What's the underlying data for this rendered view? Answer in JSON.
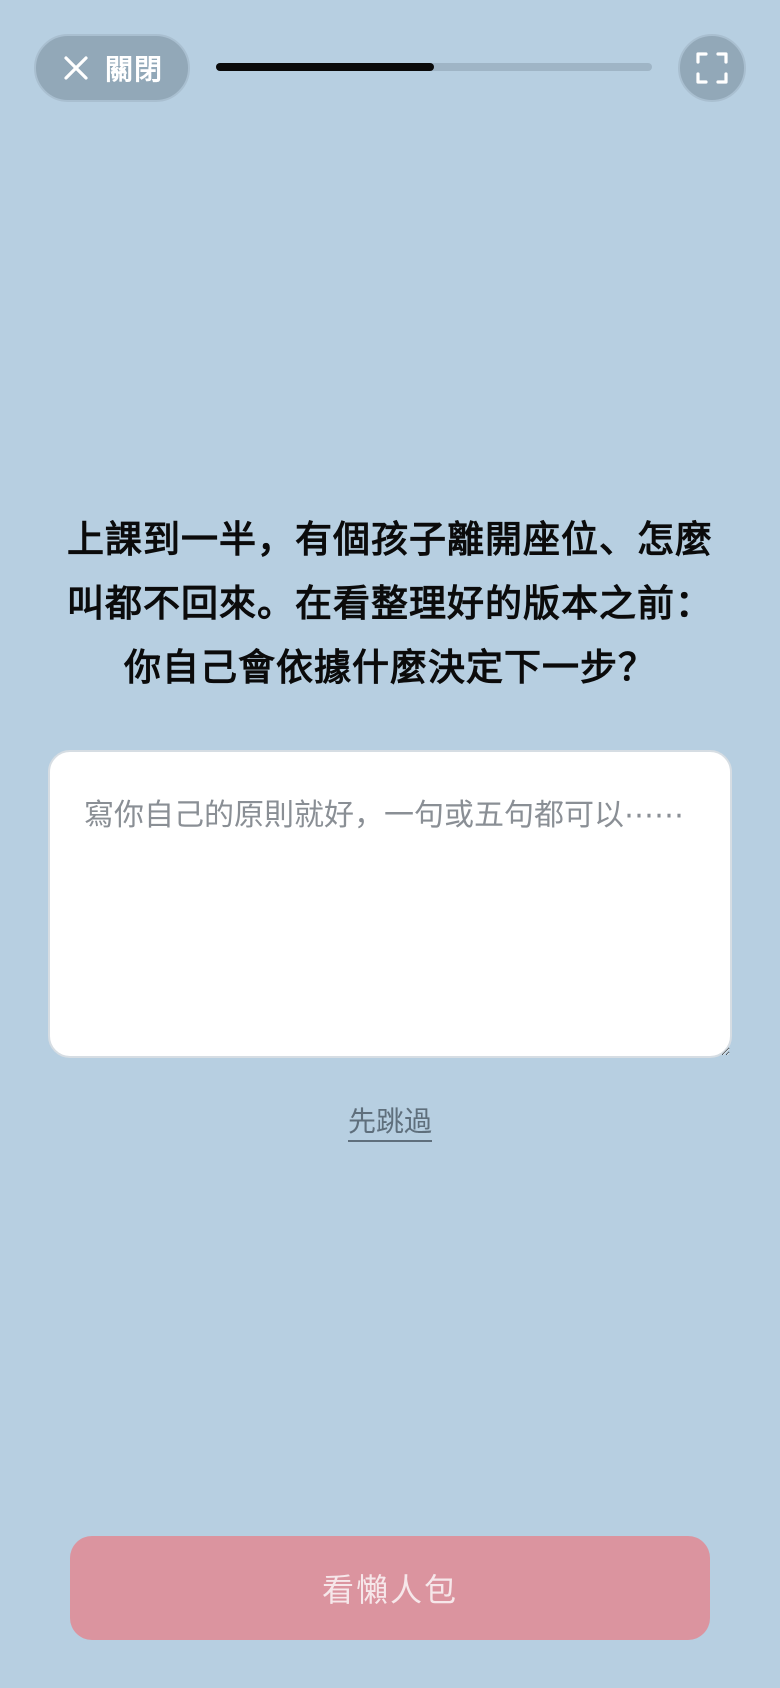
{
  "header": {
    "close_label": "關閉",
    "close_icon": "close-icon",
    "fullscreen_icon": "fullscreen-icon",
    "progress_fraction": 0.5
  },
  "question": {
    "lines": [
      "上課到一半，有個孩子離開座位、怎麼",
      "叫都不回來。在看整理好的版本之前：",
      "你自己會依據什麼決定下一步？"
    ]
  },
  "answer": {
    "placeholder": "寫你自己的原則就好，一句或五句都可以⋯⋯",
    "value": ""
  },
  "skip_label": "先跳過",
  "cta_label": "看懶人包",
  "colors": {
    "background": "#b7cfe1",
    "cta": "#db949f"
  }
}
